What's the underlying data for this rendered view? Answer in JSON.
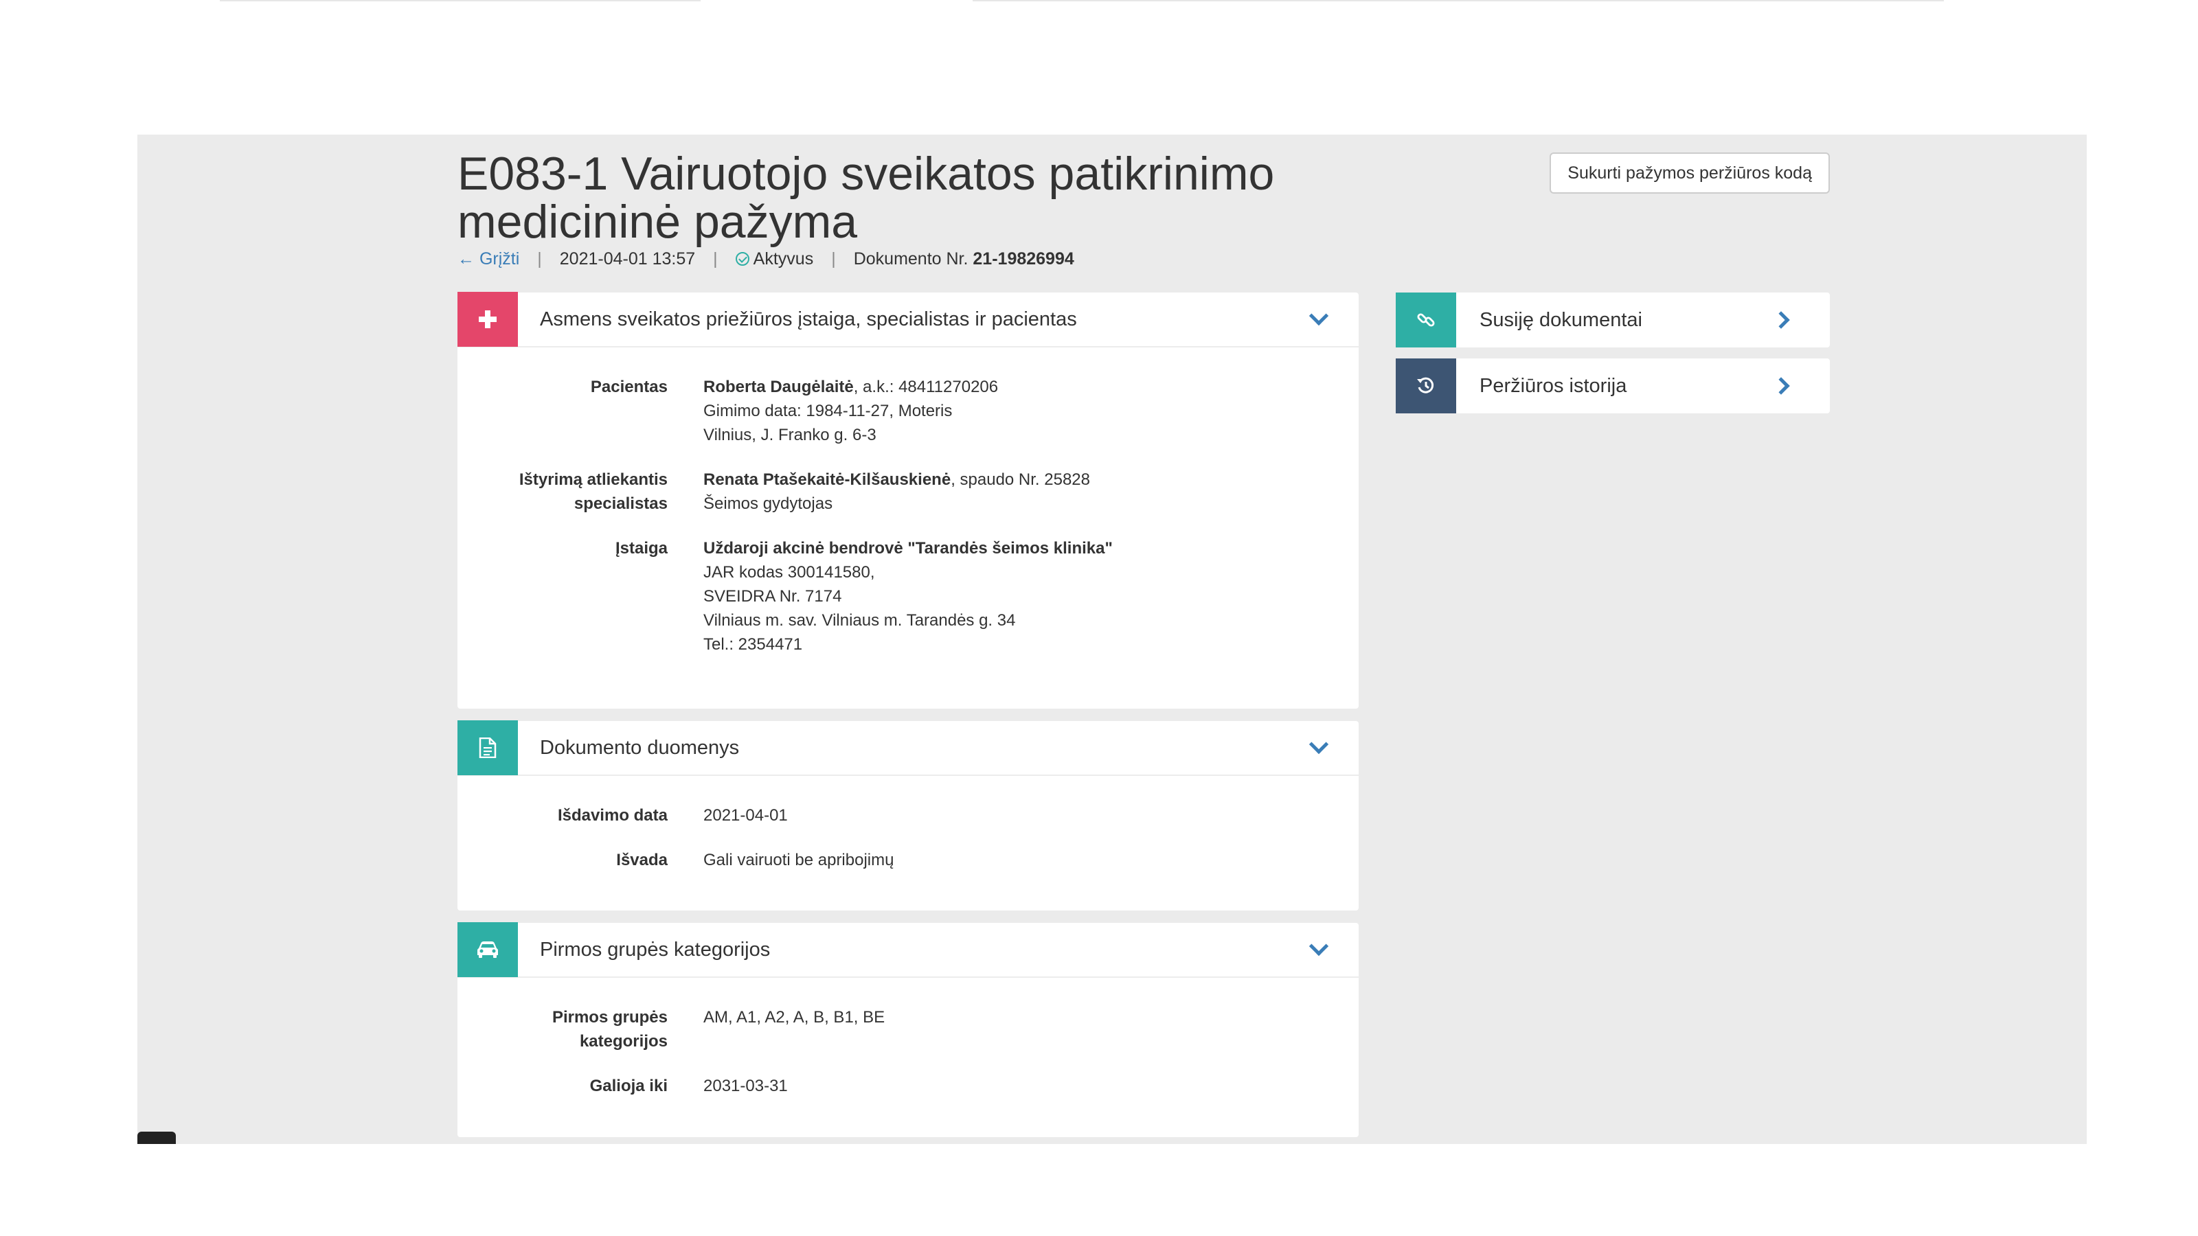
{
  "header": {
    "title": "E083-1 Vairuotojo sveikatos patikrinimo medicininė pažyma",
    "code_button": "Sukurti pažymos peržiūros kodą",
    "back": "Grįžti",
    "datetime": "2021-04-01 13:57",
    "status": "Aktyvus",
    "doc_no_label": "Dokumento Nr.",
    "doc_no": "21-19826994"
  },
  "panels": {
    "subjects": {
      "title": "Asmens sveikatos priežiūros įstaiga, specialistas ir pacientas",
      "icon": "plus-icon",
      "color": "#e4466a",
      "patient": {
        "label": "Pacientas",
        "name": "Roberta Daugėlaitė",
        "id_text": ", a.k.: 48411270206",
        "line2": "Gimimo data: 1984-11-27, Moteris",
        "line3": "Vilnius, J. Franko g. 6-3"
      },
      "specialist": {
        "label1": "Ištyrimą atliekantis",
        "label2": "specialistas",
        "name": "Renata Ptašekaitė-Kilšauskienė",
        "stamp_text": ", spaudo Nr. 25828",
        "line2": "Šeimos gydytojas"
      },
      "institution": {
        "label": "Įstaiga",
        "name": "Uždaroji akcinė bendrovė \"Tarandės šeimos klinika\"",
        "line2": "JAR kodas 300141580,",
        "line3": "SVEIDRA Nr. 7174",
        "line4": "Vilniaus m. sav. Vilniaus m. Tarandės g. 34",
        "line5": "Tel.: 2354471"
      }
    },
    "document": {
      "title": "Dokumento duomenys",
      "icon": "document-icon",
      "color": "#2eafa5",
      "issue_label": "Išdavimo data",
      "issue_value": "2021-04-01",
      "conclusion_label": "Išvada",
      "conclusion_value": "Gali vairuoti be apribojimų"
    },
    "categories": {
      "title": "Pirmos grupės kategorijos",
      "icon": "car-icon",
      "color": "#2eafa5",
      "cat_label1": "Pirmos grupės",
      "cat_label2": "kategorijos",
      "cat_value": "AM, A1, A2, A, B, B1, BE",
      "valid_label": "Galioja iki",
      "valid_value": "2031-03-31"
    }
  },
  "side": {
    "related": {
      "label": "Susiję dokumentai",
      "icon": "link-icon",
      "color": "#2eafa5"
    },
    "history": {
      "label": "Peržiūros istorija",
      "icon": "history-icon",
      "color": "#3d5573"
    }
  }
}
